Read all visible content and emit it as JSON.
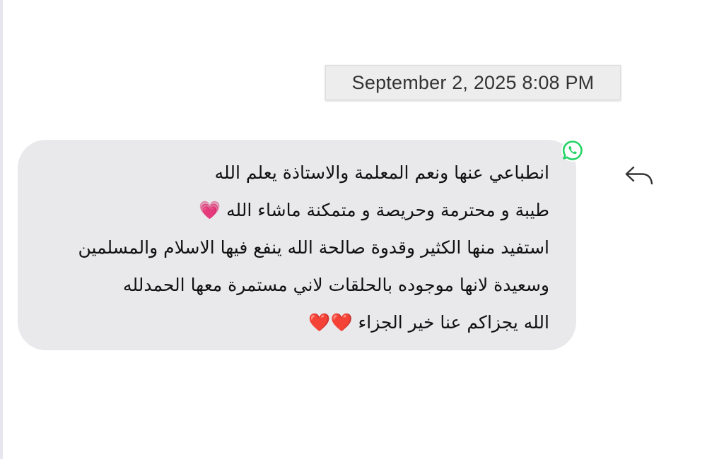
{
  "conversation": {
    "timestamp": "September 2, 2025 8:08 PM",
    "message": {
      "source_icon": "whatsapp-icon",
      "text": "انطباعي عنها ونعم المعلمة والاستاذة يعلم الله\nطيبة و محترمة وحريصة و متمكنة ماشاء الله 💗\nاستفيد منها الكثير وقدوة صالحة الله ينفع فيها الاسلام والمسلمين\nوسعيدة لانها موجوده بالحلقات لاني مستمرة معها الحمدلله\nالله يجزاكم عنا خير الجزاء ❤️❤️"
    },
    "action_icon": "reply-icon"
  },
  "colors": {
    "bubble": "#e9e9eb",
    "whatsapp_green": "#25d366",
    "timestamp_bg": "#ededed"
  }
}
